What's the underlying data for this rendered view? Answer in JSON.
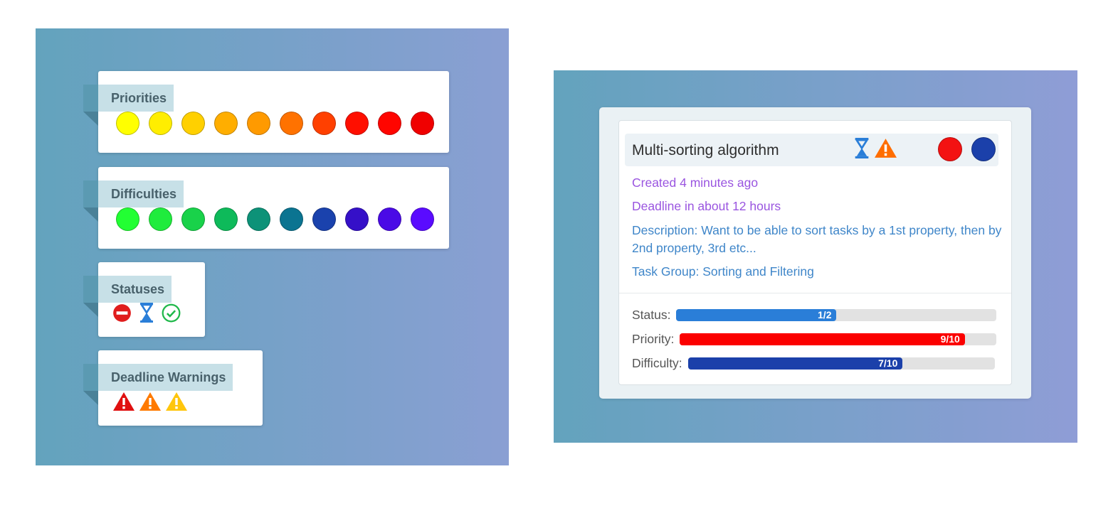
{
  "legend": {
    "priorities": {
      "label": "Priorities",
      "colors": [
        "#ffff00",
        "#ffee00",
        "#ffd000",
        "#ffae00",
        "#ff9a00",
        "#ff7200",
        "#ff4000",
        "#ff0f00",
        "#ff0500",
        "#f00000"
      ]
    },
    "difficulties": {
      "label": "Difficulties",
      "colors": [
        "#22ff33",
        "#1fec3d",
        "#19d24a",
        "#0eba5a",
        "#0d9278",
        "#0b7491",
        "#1a42ad",
        "#3510c8",
        "#4a0ae6",
        "#5a0bff"
      ]
    },
    "statuses": {
      "label": "Statuses",
      "icons": [
        "blocked-icon",
        "hourglass-icon",
        "check-circle-icon"
      ],
      "colors": [
        "#e01d1d",
        "#2a7ed8",
        "#1fb84a"
      ]
    },
    "deadline_warnings": {
      "label": "Deadline Warnings",
      "icons": [
        "warning-icon",
        "warning-icon",
        "warning-icon"
      ],
      "colors": [
        "#e01010",
        "#ff7a00",
        "#ffc60d"
      ]
    }
  },
  "task_card": {
    "title": "Multi-sorting algorithm",
    "status_icons": [
      "hourglass-icon",
      "warning-icon"
    ],
    "priority_color": "#f31212",
    "difficulty_color": "#1b40aa",
    "created": "Created 4 minutes ago",
    "deadline": "Deadline in about 12 hours",
    "description": "Description: Want to be able to sort tasks by a 1st property, then by 2nd property, 3rd etc...",
    "task_group": "Task Group: Sorting and Filtering",
    "bars": {
      "status": {
        "label": "Status:",
        "text": "1/2",
        "fraction": 0.5,
        "color": "#2a7ed8"
      },
      "priority": {
        "label": "Priority:",
        "text": "9/10",
        "fraction": 0.9,
        "color": "#fb0000"
      },
      "difficulty": {
        "label": "Difficulty:",
        "text": "7/10",
        "fraction": 0.7,
        "color": "#1b40aa"
      }
    }
  }
}
